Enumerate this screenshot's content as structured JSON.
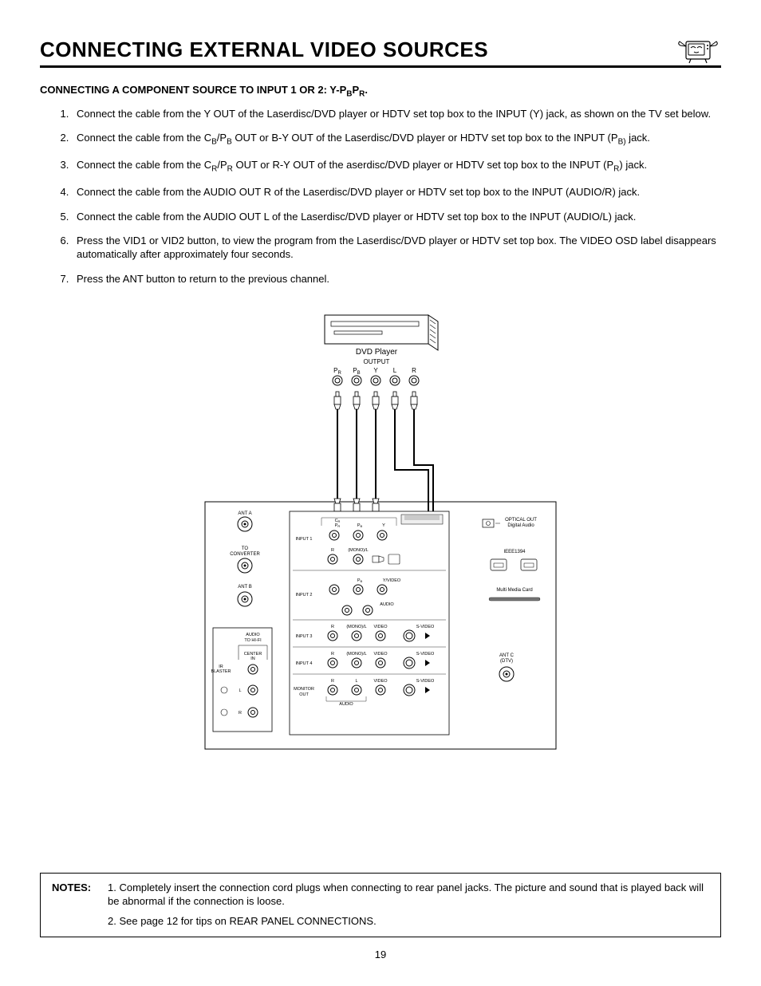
{
  "title": "CONNECTING EXTERNAL VIDEO SOURCES",
  "subhead_prefix": "CONNECTING A COMPONENT SOURCE TO INPUT 1 OR 2:  Y-P",
  "subhead_b": "B",
  "subhead_p2": "P",
  "subhead_r": "R",
  "subhead_period": ".",
  "steps": {
    "s1": "Connect the cable from the Y OUT of the Laserdisc/DVD player or HDTV set top box to the INPUT (Y) jack, as shown on the TV set below.",
    "s2a": "Connect the cable from the C",
    "s2b": "B",
    "s2c": "/P",
    "s2d": "B",
    "s2e": " OUT or B-Y OUT of the Laserdisc/DVD  player or HDTV set top box to the INPUT (P",
    "s2f": "B)",
    "s2g": " jack.",
    "s3a": "Connect the cable from the C",
    "s3b": "R",
    "s3c": "/P",
    "s3d": "R",
    "s3e": " OUT or R-Y OUT of the aserdisc/DVD player or HDTV set top box to the INPUT (P",
    "s3f": "R",
    "s3g": ") jack.",
    "s4": "Connect the cable from the AUDIO OUT R of the Laserdisc/DVD player or   HDTV set top box to the INPUT (AUDIO/R) jack.",
    "s5": "Connect the cable from the AUDIO OUT L of the Laserdisc/DVD player or HDTV set top box to the INPUT (AUDIO/L) jack.",
    "s6": "Press the VID1 or VID2 button, to view the program from the Laserdisc/DVD player or HDTV set top box.  The VIDEO OSD label disappears automatically after approximately four seconds.",
    "s7": "Press the ANT button to return to the previous channel."
  },
  "diagram": {
    "dvd_label": "DVD Player",
    "output_label": "OUTPUT",
    "jacks": {
      "pr": "P",
      "pr_sub": "R",
      "pb": "P",
      "pb_sub": "B",
      "y": "Y",
      "l": "L",
      "r": "R"
    },
    "panel": {
      "ant_a": "ANT A",
      "to_conv1": "TO",
      "to_conv2": "CONVERTER",
      "ant_b": "ANT B",
      "audio_hifi1": "AUDIO",
      "audio_hifi2": "TO HI-FI",
      "center_in1": "CENTER",
      "center_in2": "IN",
      "ir1": "IR",
      "ir2": "BLASTER",
      "l_small": "L",
      "r_small": "R",
      "input1": "INPUT 1",
      "input2": "INPUT 2",
      "input3": "INPUT 3",
      "input4": "INPUT 4",
      "monitor1": "MONITOR",
      "monitor2": "OUT",
      "pb_lbl": "P",
      "pb_lbl_sub": "B",
      "pr_lbl": "P",
      "pr_lbl_sub": "R",
      "y_lbl": "Y",
      "cr_lbl": "C",
      "cr_lbl_sub": "R",
      "audio_lbl": "AUDIO",
      "r_lbl": "R",
      "mono_l": "(MONO)/L",
      "l_lbl": "L",
      "video_lbl": "VIDEO",
      "yvideo_lbl": "Y/VIDEO",
      "svideo_lbl": "S-VIDEO",
      "optical1": "OPTICAL OUT",
      "optical2": "Digital Audio",
      "ieee": "IEEE1394",
      "mmc": "Multi Media Card",
      "ant_c1": "ANT C",
      "ant_c2": "(DTV)",
      "audio_foot": "AUDIO"
    }
  },
  "notes": {
    "label": "NOTES:",
    "n1": "1.  Completely insert the connection cord plugs when connecting to rear panel jacks.  The picture and sound that is played back will be abnormal if the connection is loose.",
    "n2": "2.  See page 12 for tips on REAR PANEL CONNECTIONS."
  },
  "page": "19"
}
